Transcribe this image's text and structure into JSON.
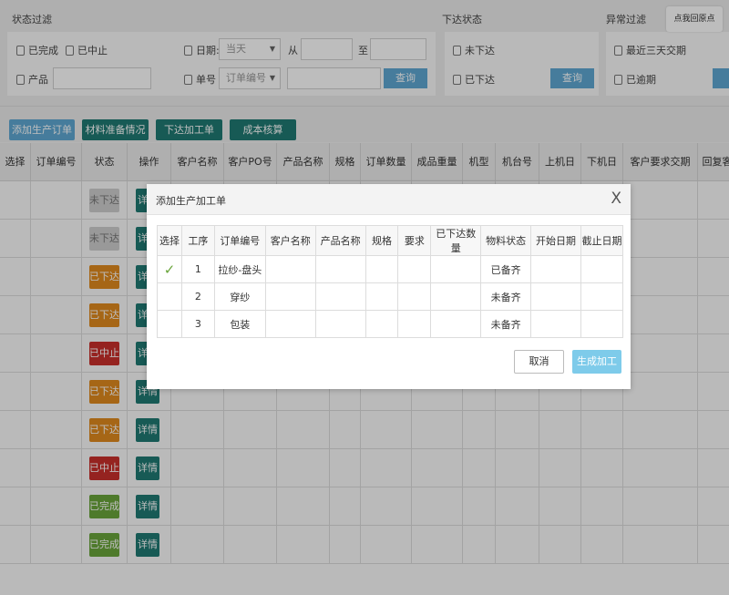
{
  "filters": {
    "status_filter": {
      "title": "状态过滤",
      "completed": "已完成",
      "stopped": "已中止",
      "date_label": "日期:",
      "date_select": "当天",
      "from_label": "从",
      "to_label": "至",
      "product_label": "产品",
      "order_label": "单号",
      "order_select": "订单编号",
      "query_button": "查询"
    },
    "dispatch_status": {
      "title": "下达状态",
      "not_dispatched": "未下达",
      "dispatched": "已下达",
      "query_button": "查询"
    },
    "exception_filter": {
      "title": "异常过滤",
      "recent_three_days": "最近三天交期",
      "overdue": "已逾期"
    },
    "tooltip": "点我回原点"
  },
  "toolbar": {
    "add_order": "添加生产订单",
    "material_prep": "材料准备情况",
    "dispatch_work": "下达加工单",
    "cost_check": "成本核算"
  },
  "grid": {
    "columns": [
      "选择",
      "订单编号",
      "状态",
      "操作",
      "客户名称",
      "客户PO号",
      "产品名称",
      "规格",
      "订单数量",
      "成品重量",
      "机型",
      "机台号",
      "上机日",
      "下机日",
      "客户要求交期",
      "回复客户"
    ],
    "rows": [
      {
        "status": "未下达",
        "action": "详情"
      },
      {
        "status": "未下达",
        "action": "详情"
      },
      {
        "status": "已下达",
        "action": "详情"
      },
      {
        "status": "已下达",
        "action": "详情"
      },
      {
        "status": "已中止",
        "action": "详情"
      },
      {
        "status": "已下达",
        "action": "详情"
      },
      {
        "status": "已下达",
        "action": "详情"
      },
      {
        "status": "已中止",
        "action": "详情"
      },
      {
        "status": "已完成",
        "action": "详情"
      },
      {
        "status": "已完成",
        "action": "详情"
      }
    ]
  },
  "status_colors": {
    "未下达": "#cfcfcf",
    "已下达": "#e08a1e",
    "已中止": "#c9302c",
    "已完成": "#6aa53b"
  },
  "modal": {
    "title": "添加生产加工单",
    "close": "X",
    "columns": [
      "选择",
      "工序",
      "订单编号",
      "客户名称",
      "产品名称",
      "规格",
      "要求",
      "已下达数量",
      "物料状态",
      "开始日期",
      "截止日期"
    ],
    "rows": [
      {
        "checked": true,
        "seq": "1",
        "order": "拉纱-盘头",
        "material": "已备齐",
        "ready": true
      },
      {
        "checked": false,
        "seq": "2",
        "order": "穿纱",
        "material": "未备齐",
        "ready": false
      },
      {
        "checked": false,
        "seq": "3",
        "order": "包装",
        "material": "未备齐",
        "ready": false
      }
    ],
    "cancel": "取消",
    "generate": "生成加工单"
  },
  "colors": {
    "primary": "#5fa8d3",
    "teal": "#1f7a73",
    "generate_btn": "#7ecbea"
  }
}
